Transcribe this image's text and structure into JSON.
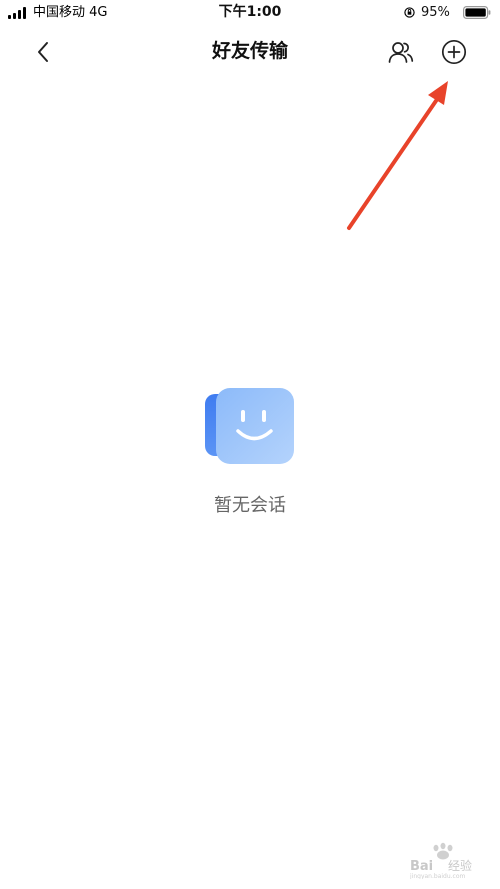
{
  "status_bar": {
    "carrier": "中国移动 4G",
    "time": "下午1:00",
    "battery_percent": "95%",
    "icons": [
      "signal-icon",
      "orientation-lock-icon",
      "battery-icon"
    ]
  },
  "nav_bar": {
    "title": "好友传输",
    "icons": [
      "back-chevron-icon",
      "friends-icon",
      "add-circle-icon"
    ]
  },
  "empty_state": {
    "message": "暂无会话",
    "icon": "smiley-chat-icon"
  },
  "annotation": {
    "arrow_color": "#e8432a"
  },
  "watermark": {
    "brand": "Baidu 经验",
    "url": "jingyan.baidu.com"
  },
  "colors": {
    "accent_blue": "#5a94f2",
    "text_secondary": "#666666"
  }
}
